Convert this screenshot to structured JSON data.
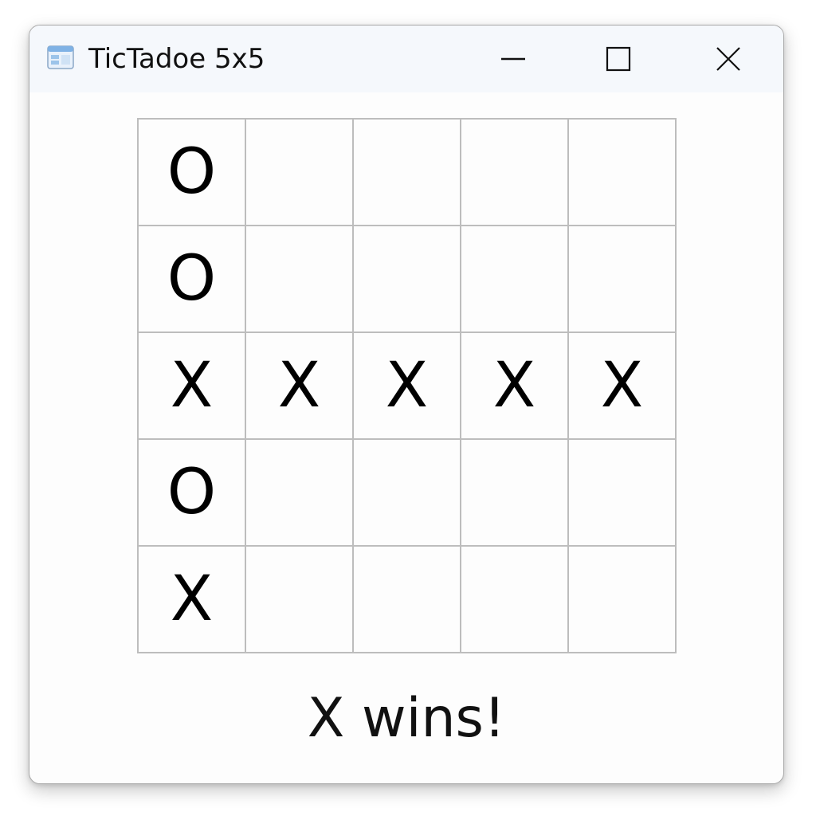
{
  "window": {
    "title": "TicTadoe 5x5",
    "icon": "window-app-icon",
    "controls": {
      "minimize_icon": "minimize-icon",
      "maximize_icon": "maximize-icon",
      "close_icon": "close-icon"
    }
  },
  "board": {
    "size": "5x5",
    "cells": [
      [
        "O",
        "",
        "",
        "",
        ""
      ],
      [
        "O",
        "",
        "",
        "",
        ""
      ],
      [
        "X",
        "X",
        "X",
        "X",
        "X"
      ],
      [
        "O",
        "",
        "",
        "",
        ""
      ],
      [
        "X",
        "",
        "",
        "",
        ""
      ]
    ]
  },
  "status": {
    "message": "X wins!"
  },
  "colors": {
    "titlebar_bg": "#f5f8fc",
    "window_bg": "#fdfdfd",
    "grid_line": "#bdbdbd",
    "mark": "#000000"
  }
}
